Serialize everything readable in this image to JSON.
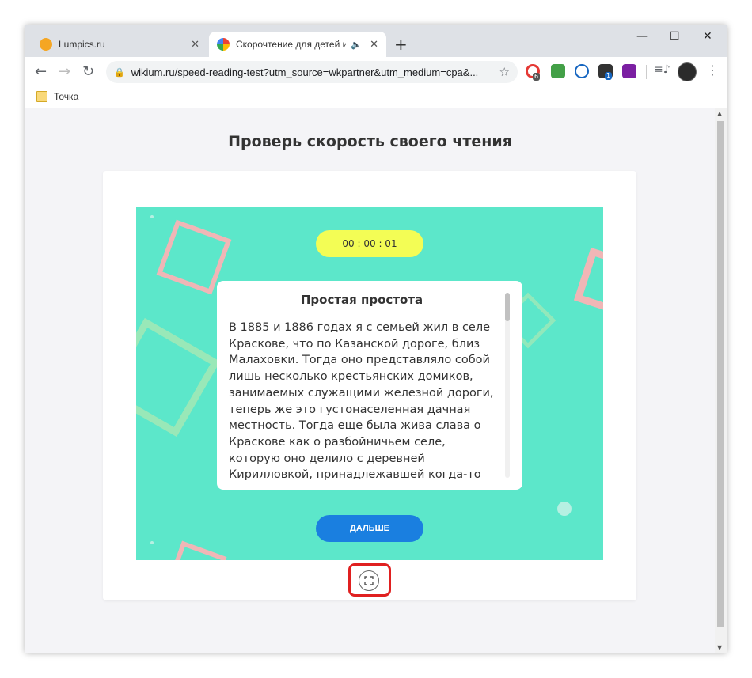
{
  "browser": {
    "tabs": [
      {
        "title": "Lumpics.ru",
        "active": false
      },
      {
        "title": "Скорочтение для детей и в",
        "active": true,
        "audio": true
      }
    ],
    "new_tab_label": "+",
    "window_controls": {
      "minimize": "—",
      "maximize": "☐",
      "close": "✕"
    },
    "address": "wikium.ru/speed-reading-test?utm_source=wkpartner&utm_medium=cpa&...",
    "extensions": {
      "badge_1": "6",
      "badge_4": "1"
    },
    "bookmarks": [
      {
        "label": "Точка"
      }
    ]
  },
  "page": {
    "heading": "Проверь скорость своего чтения",
    "timer": "00 : 00 : 01",
    "text_title": "Простая простота",
    "text_body": "В 1885 и 1886 годах я с семьей жил в селе Краскове, что по Казанской дороге, близ Малаховки. Тогда оно представляло собой лишь несколько крестьянских домиков, занимаемых служащими железной дороги, теперь же это густонаселенная дачная местность. Тогда еще была жива слава о Краскове как о разбойничьем селе, которую оно делило с деревней Кирилловкой, принадлежавшей когда-то знаменитой",
    "next_button": "ДАЛЬШЕ"
  },
  "colors": {
    "stage_bg": "#5ce7ca",
    "timer_bg": "#f3fd55",
    "button_bg": "#1a7fe0",
    "highlight": "#e02020"
  }
}
